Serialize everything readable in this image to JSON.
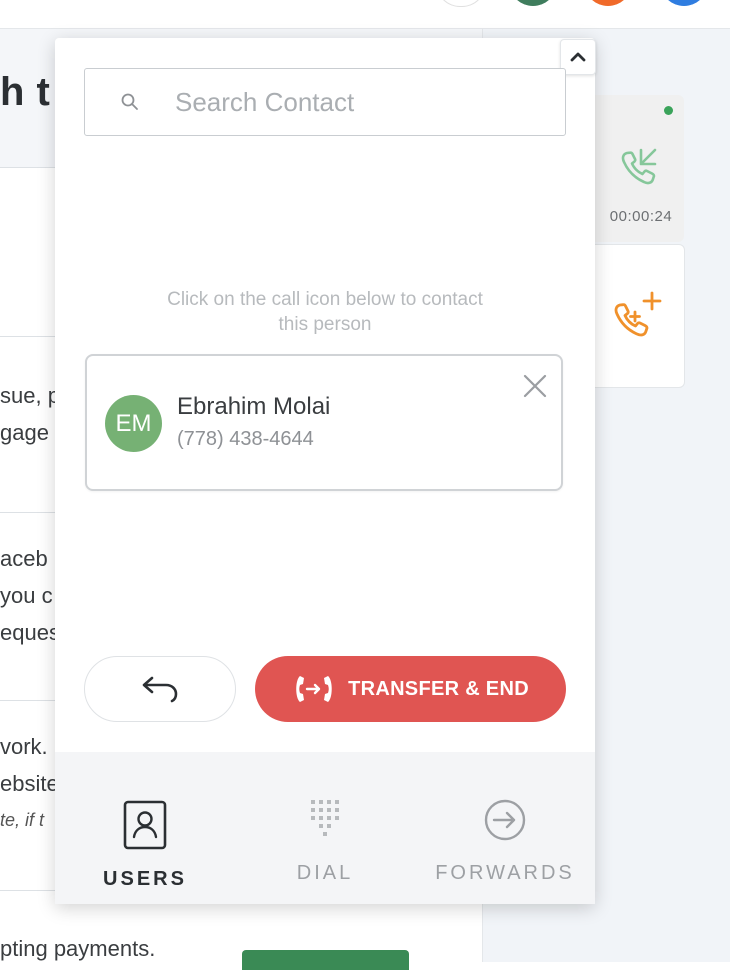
{
  "background": {
    "heading_fragment": "h t",
    "text_lines": [
      {
        "text": "sue, p",
        "top": 0
      },
      {
        "text": "gage v",
        "top": 0
      },
      {
        "text": "aceb",
        "top": 0
      },
      {
        "text": "you c",
        "top": 0
      },
      {
        "text": "eques",
        "top": 0
      },
      {
        "text": "vork. I",
        "top": 0
      },
      {
        "text": "ebsite",
        "top": 0
      },
      {
        "text": "te, if t",
        "top": 0
      },
      {
        "text": "pting payments.",
        "top": 0
      }
    ]
  },
  "call_panel": {
    "timer": "00:00:24",
    "status_color": "#3aa35a",
    "call_icon": "phone-incoming-icon",
    "add_call_icon": "phone-add-icon"
  },
  "transfer_panel": {
    "search": {
      "placeholder": "Search Contact",
      "value": ""
    },
    "hint": "Click on the call icon below to contact this person",
    "contact": {
      "initials": "EM",
      "name": "Ebrahim Molai",
      "phone": "(778) 438-4644",
      "avatar_color": "#76b174"
    },
    "actions": {
      "back_icon": "undo-arrow-icon",
      "transfer_label": "TRANSFER & END",
      "transfer_color": "#e05552"
    },
    "tabs": [
      {
        "label": "USERS",
        "icon": "user-card-icon",
        "active": true
      },
      {
        "label": "DIAL",
        "icon": "dialpad-icon",
        "active": false
      },
      {
        "label": "FORWARDS",
        "icon": "forward-circle-icon",
        "active": false
      }
    ]
  }
}
